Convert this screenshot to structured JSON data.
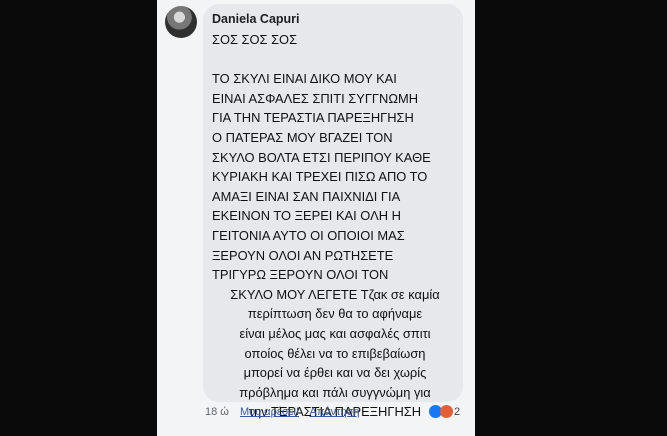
{
  "comment": {
    "author": "Daniela Capuri",
    "lines": [
      "ΣΟΣ ΣΟΣ ΣΟΣ",
      "",
      "ΤΟ ΣΚΥΛΙ ΕΙΝΑΙ ΔΙΚΟ ΜΟΥ ΚΑΙ",
      "ΕΙΝΑΙ ΑΣΦΑΛΕΣ ΣΠΙΤΙ ΣΥΓΓΝΩΜΗ",
      "ΓΙΑ ΤΗΝ ΤΕΡΑΣΤΙΑ ΠΑΡΕΞΗΓΗΣΗ",
      "Ο ΠΑΤΕΡΑΣ ΜΟΥ ΒΓΑΖΕΙ ΤΟΝ",
      "ΣΚΥΛΟ ΒΟΛΤΑ ΕΤΣΙ ΠΕΡΙΠΟΥ ΚΑΘΕ",
      "ΚΥΡΙΑΚΗ ΚΑΙ ΤΡΕΧΕΙ ΠΙΣΩ ΑΠΟ ΤΟ",
      "ΑΜΑΞΙ  ΕΙΝΑΙ ΣΑΝ ΠΑΙΧΝΙΔΙ ΓΙΑ",
      "ΕΚΕΙΝΟΝ ΤΟ ΞΕΡΕΙ ΚΑΙ ΟΛΗ Η",
      "ΓΕΙΤΟΝΙΑ ΑΥΤΟ ΟΙ ΟΠΟΙΟΙ ΜΑΣ",
      "ΞΕΡΟΥΝ ΟΛΟΙ ΑΝ ΡΩΤΗΣΕΤΕ",
      "ΤΡΙΓΥΡΩ ΞΕΡΟΥΝ ΟΛΟΙ ΤΟΝ",
      "ΣΚΥΛΟ ΜΟΥ ΛΕΓΕΤΕ Τζακ σε καμία",
      "περίπτωση δεν θα το αφήναμε",
      "είναι μέλος μας και ασφαλές σπιτι",
      "οποίος θέλει να το επιβεβαίωση",
      "μπορεί να έρθει και να δει χωρίς",
      "πρόβλημα και πάλι συγγνώμη για",
      "την ΤΕΡΑΣΤΙΑ ΠΑΡΕΞΗΓΗΣΗ"
    ]
  },
  "actions": {
    "time": "18 ώ",
    "like": "Μου αρέσει!",
    "reply": "Απάντηση"
  },
  "reactions": {
    "count": "2",
    "icons": [
      "like-icon",
      "angry-icon"
    ]
  }
}
